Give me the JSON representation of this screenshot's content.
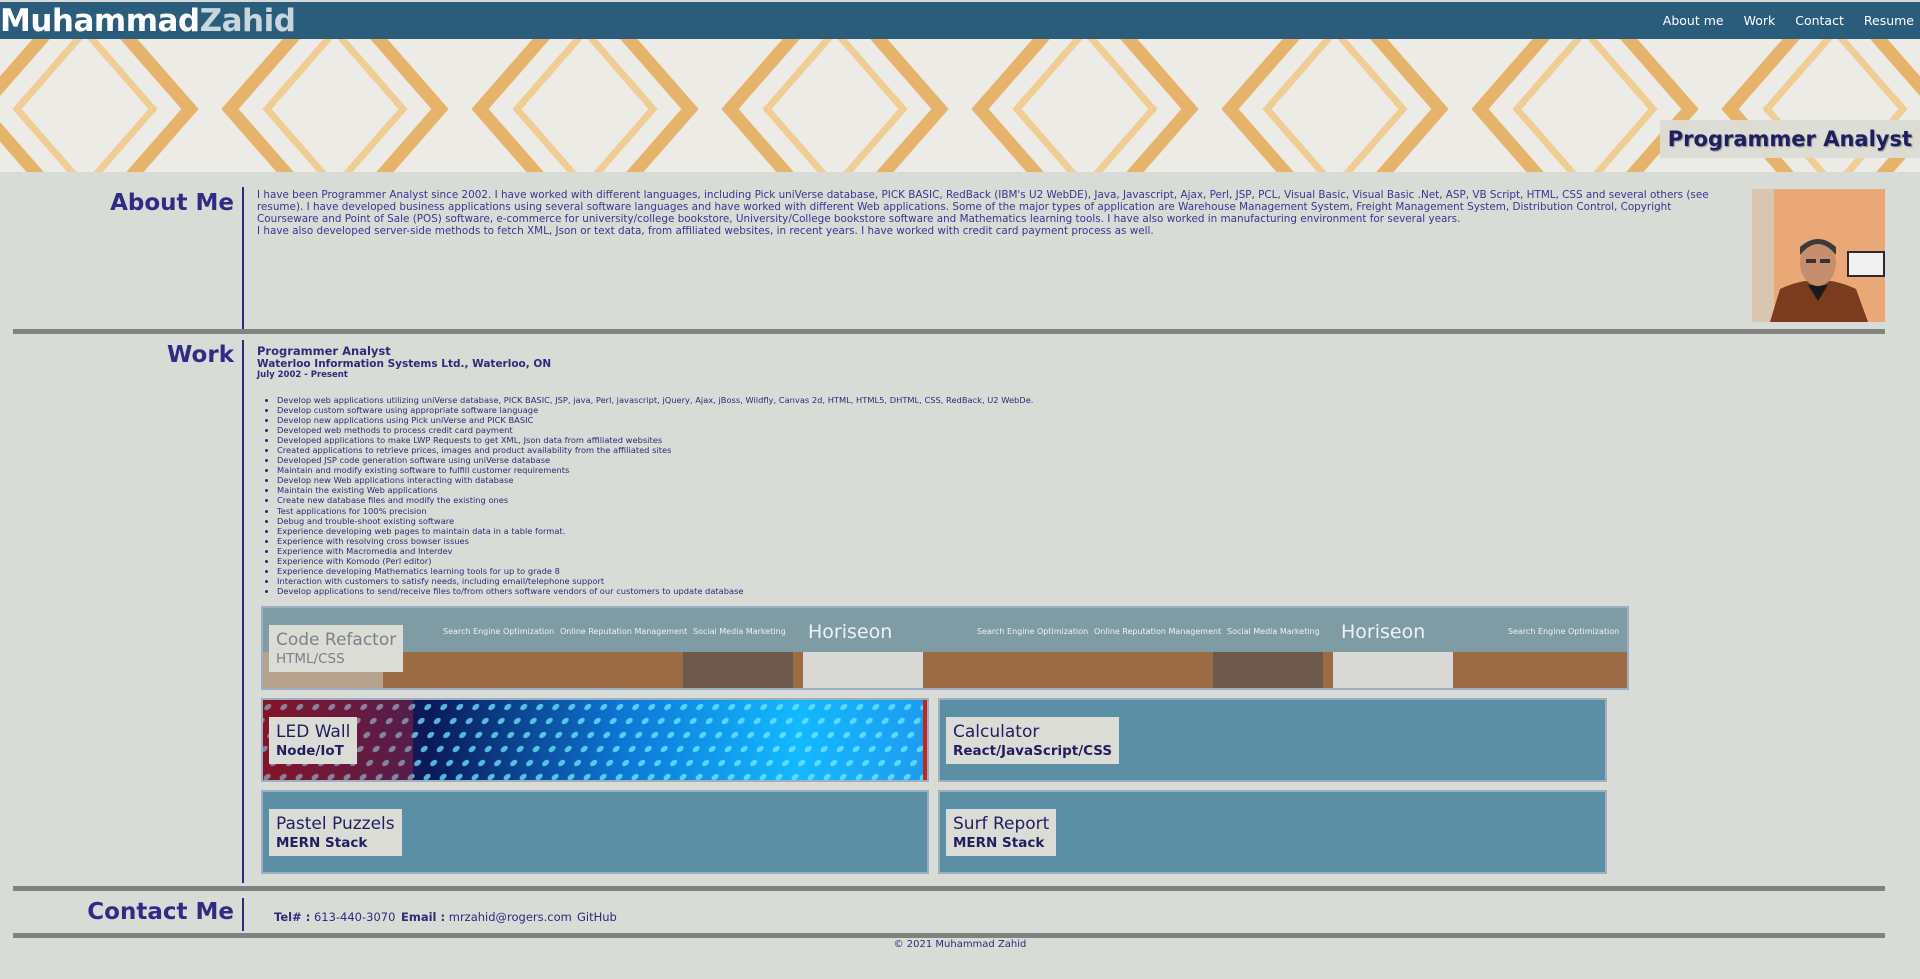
{
  "header": {
    "brand_first": "Muhammad",
    "brand_last": "Zahid",
    "nav": [
      "About me",
      "Work",
      "Contact",
      "Resume"
    ]
  },
  "hero": {
    "title": "Programmer Analyst"
  },
  "about": {
    "heading": "About Me",
    "paragraph1": "I have been Programmer Analyst since 2002. I have worked with different languages, including Pick uniVerse database, PICK BASIC, RedBack (IBM's U2 WebDE), Java, Javascript, Ajax, Perl, JSP, PCL, Visual Basic, Visual Basic .Net, ASP, VB Script, HTML, CSS and several others (see resume). I have developed business applications using several software languages and have worked with different Web applications. Some of the major types of application are Warehouse Management System, Freight Management System, Distribution Control, Copyright Courseware and Point of Sale (POS) software, e-commerce for university/college bookstore, University/College bookstore software and Mathematics learning tools. I have also worked in manufacturing environment for several years.",
    "paragraph2": "I have also developed server-side methods to fetch XML, Json or text data, from affiliated websites, in recent years. I have worked with credit card payment process as well."
  },
  "work": {
    "heading": "Work",
    "job_title": "Programmer Analyst",
    "company": "Waterloo Information Systems Ltd., Waterloo, ON",
    "dates": "July 2002 - Present",
    "duties": [
      "Develop web applications utilizing uniVerse database, PICK BASIC, JSP, java, Perl, javascript, jQuery, Ajax, jBoss, Wildfly, Canvas 2d, HTML, HTML5, DHTML, CSS, RedBack, U2 WebDe.",
      "Develop custom software using appropriate software language",
      "Develop new applications using Pick uniVerse and PICK BASIC",
      "Developed web methods to process credit card payment",
      "Developed applications to make LWP Requests to get XML, Json data from affiliated websites",
      "Created applications to retrieve prices, images and product availability from the affiliated sites",
      "Developed JSP code generation software using uniVerse database",
      "Maintain and modify existing software to fulfill customer requirements",
      "Develop new Web applications interacting with database",
      "Maintain the existing Web applications",
      "Create new database files and modify the existing ones",
      "Test applications for 100% precision",
      "Debug and trouble-shoot existing software",
      "Experience developing web pages to maintain data in a table format.",
      "Experience with resolving cross bowser issues",
      "Experience with Macromedia and Interdev",
      "Experience with Komodo (Perl editor)",
      "Experience developing Mathematics learning tools for up to grade 8",
      "Interaction with customers to satisfy needs, including email/telephone support",
      "Develop applications to send/receive files to/from others software vendors of our customers to update database"
    ],
    "projects": [
      {
        "name": "Code Refactor",
        "tech": "HTML/CSS"
      },
      {
        "name": "LED Wall",
        "tech": "Node/IoT"
      },
      {
        "name": "Calculator",
        "tech": "React/JavaScript/CSS"
      },
      {
        "name": "Pastel Puzzels",
        "tech": "MERN Stack"
      },
      {
        "name": "Surf Report",
        "tech": "MERN Stack"
      }
    ],
    "banner": {
      "logo": "Horiseon",
      "links": [
        "Search Engine Optimization",
        "Online Reputation Management",
        "Social Media Marketing"
      ]
    }
  },
  "contact": {
    "heading": "Contact Me",
    "tel_label": "Tel# :",
    "tel": "613-440-3070",
    "email_label": "Email :",
    "email": "mrzahid@rogers.com",
    "github": "GitHub"
  },
  "footer": {
    "copyright": "© 2021 Muhammad Zahid"
  },
  "colors": {
    "topbar": "#2a5d7c",
    "page_bg": "#d9dbd6",
    "text": "#2f2a7a",
    "card_bg": "#5b8fa6",
    "rule": "#808380"
  }
}
